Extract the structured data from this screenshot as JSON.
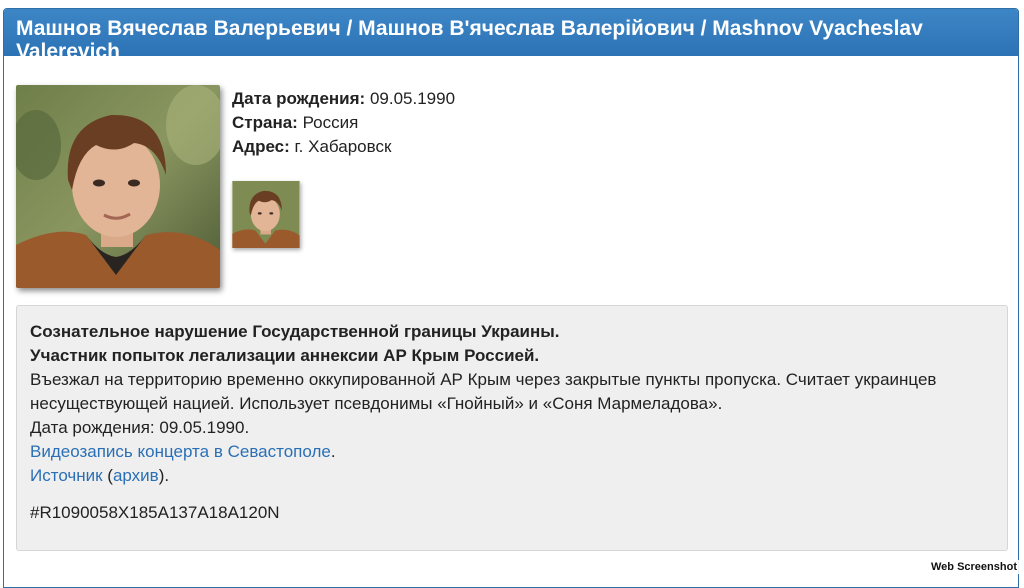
{
  "header": {
    "title": "Машнов Вячеслав Валерьевич / Машнов В'ячеслав Валерійович / Mashnov Vyacheslav Valerevich"
  },
  "profile": {
    "dob_label": "Дата рождения:",
    "dob_value": "09.05.1990",
    "country_label": "Страна:",
    "country_value": "Россия",
    "address_label": "Адрес:",
    "address_value": "г. Хабаровск"
  },
  "description": {
    "line1": "Сознательное нарушение Государственной границы Украины.",
    "line2": "Участник попыток легализации аннексии АР Крым Россией.",
    "text": "Въезжал на территорию временно оккупированной АР Крым через закрытые пункты пропуска. Считает украинцев несуществующей нацией. Использует псевдонимы «Гнойный» и «Соня Мармеладова».",
    "dob_text": "Дата рождения: 09.05.1990.",
    "video_link": "Видеозапись концерта в Севастополе",
    "video_suffix": ".",
    "source_link": "Источник",
    "archive_open": " (",
    "archive_link": "архив",
    "archive_close": ").",
    "code": "#R1090058X185A137A18A120N"
  },
  "watermark": "Web Screenshot",
  "colors": {
    "header_bg": "#2c73b5",
    "link": "#2a6fb5",
    "panel_bg": "#efefef"
  }
}
